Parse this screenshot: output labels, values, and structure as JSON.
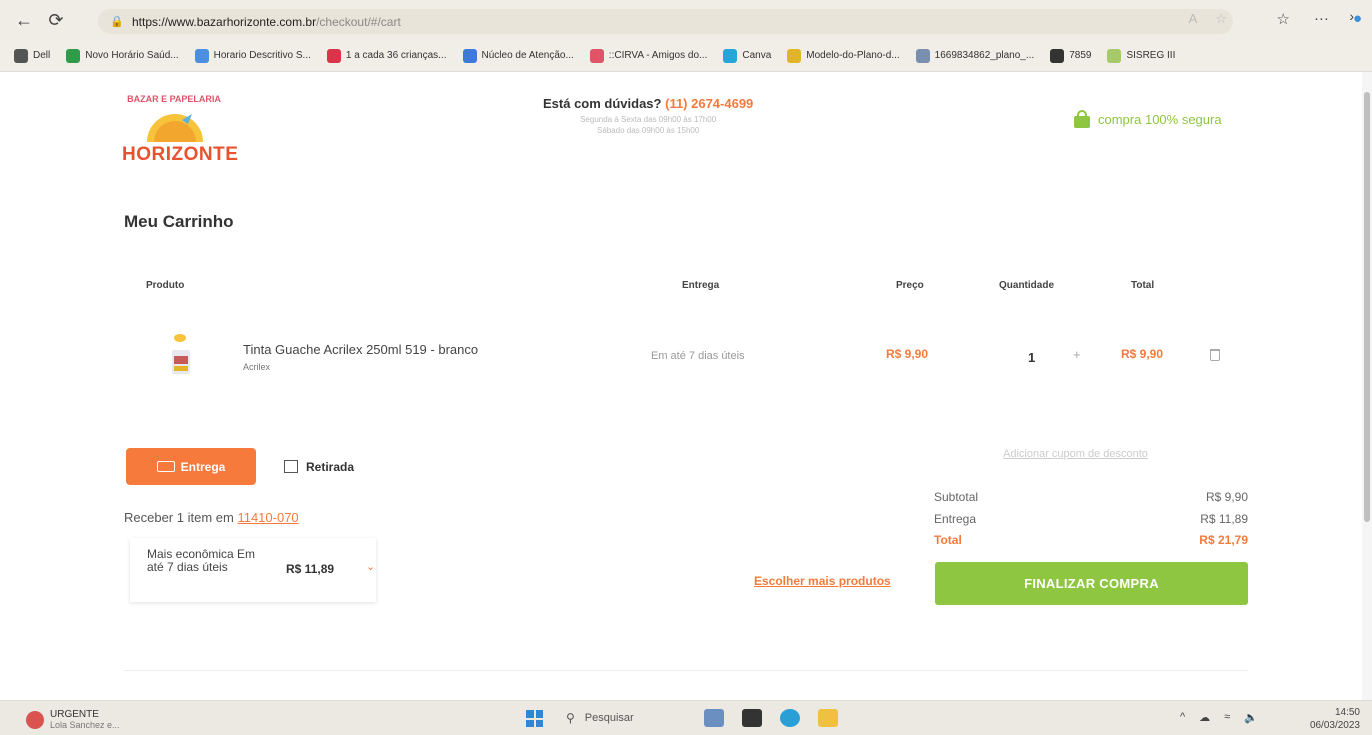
{
  "browser": {
    "url_host": "https://www.bazarhorizonte.com.br",
    "url_path": "/checkout/#/cart",
    "bookmarks": [
      {
        "label": "Dell",
        "color": "#555555"
      },
      {
        "label": "Novo Horário Saúd...",
        "color": "#2e9d4a"
      },
      {
        "label": "Horario Descritivo S...",
        "color": "#4a8fe0"
      },
      {
        "label": "1 a cada 36 crianças...",
        "color": "#d9344a"
      },
      {
        "label": "Núcleo de Atenção...",
        "color": "#3d7ad6"
      },
      {
        "label": "::CIRVA - Amigos do...",
        "color": "#e0546a"
      },
      {
        "label": "Canva",
        "color": "#26a6d8"
      },
      {
        "label": "Modelo-do-Plano-d...",
        "color": "#e0b52a"
      },
      {
        "label": "1669834862_plano_...",
        "color": "#7a8fb0"
      },
      {
        "label": "7859",
        "color": "#333333"
      },
      {
        "label": "SISREG III",
        "color": "#a6c96a"
      }
    ]
  },
  "header": {
    "logo_arc_text": "BAZAR E PAPELARIA",
    "logo_text": "HORIZONTE",
    "help_question": "Está com dúvidas?",
    "help_phone": "(11) 2674-4699",
    "help_hours_1": "Segunda à Sexta das 09h00 às 17h00",
    "help_hours_2": "Sábado das 09h00 às 15h00",
    "secure_label": "compra 100% segura"
  },
  "cart": {
    "title": "Meu Carrinho",
    "columns": {
      "product": "Produto",
      "delivery": "Entrega",
      "price": "Preço",
      "quantity": "Quantidade",
      "total": "Total"
    },
    "item": {
      "name": "Tinta Guache Acrilex 250ml 519 - branco",
      "brand": "Acrilex",
      "delivery": "Em até 7 dias úteis",
      "price": "R$ 9,90",
      "quantity": "1",
      "plus": "+",
      "total": "R$ 9,90"
    }
  },
  "shipping": {
    "tab_delivery": "Entrega",
    "tab_pickup": "Retirada",
    "receive_prefix": "Receber 1 item em",
    "zip": "11410-070",
    "option_label": "Mais econômica Em até 7 dias úteis",
    "option_price": "R$ 11,89"
  },
  "summary": {
    "coupon": "Adicionar cupom de desconto",
    "subtotal_label": "Subtotal",
    "subtotal_value": "R$ 9,90",
    "delivery_label": "Entrega",
    "delivery_value": "R$ 11,89",
    "total_label": "Total",
    "total_value": "R$ 21,79",
    "more_products": "Escolher mais produtos",
    "checkout_button": "FINALIZAR COMPRA"
  },
  "taskbar": {
    "notification_title": "URGENTE",
    "notification_sub": "Lola Sanchez e...",
    "search_label": "Pesquisar",
    "time": "14:50",
    "date": "06/03/2023"
  },
  "colors": {
    "accent_orange": "#f57a3c",
    "accent_green": "#8ec641"
  }
}
